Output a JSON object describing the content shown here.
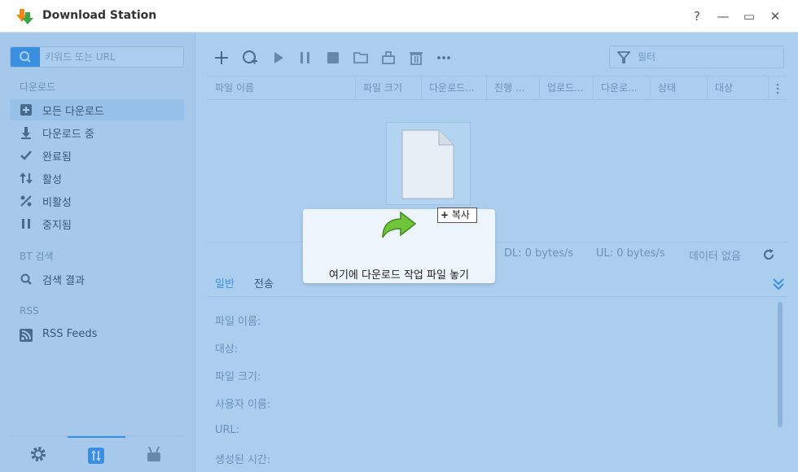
{
  "window": {
    "title": "Download Station"
  },
  "window_controls": {
    "help": "?",
    "minimize": "—",
    "maximize": "▭",
    "close": "✕"
  },
  "sidebar": {
    "search_placeholder": "키워드 또는 URL",
    "section_download": "다운로드",
    "items": [
      {
        "label": "모든 다운로드",
        "icon": "add-download-icon",
        "active": true
      },
      {
        "label": "다운로드 중",
        "icon": "download-arrow-icon"
      },
      {
        "label": "완료됨",
        "icon": "checkmark-icon"
      },
      {
        "label": "활성",
        "icon": "up-down-arrows-icon"
      },
      {
        "label": "비활성",
        "icon": "inactive-icon"
      },
      {
        "label": "중지됨",
        "icon": "pause-icon"
      }
    ],
    "section_bt": "BT 검색",
    "bt_items": [
      {
        "label": "검색 결과",
        "icon": "search-icon"
      }
    ],
    "section_rss": "RSS",
    "rss_items": [
      {
        "label": "RSS Feeds",
        "icon": "rss-icon"
      }
    ],
    "bottom_tabs": [
      "settings-icon",
      "transfer-icon",
      "robot-icon"
    ]
  },
  "toolbar": {
    "icons": [
      "add-icon",
      "add-url-icon",
      "play-icon",
      "pause-icon",
      "stop-icon",
      "folder-icon",
      "package-icon",
      "trash-icon",
      "more-icon"
    ],
    "filter_placeholder": "필터"
  },
  "table": {
    "columns": [
      "파일 이름",
      "파일 크기",
      "다운로드...",
      "진행 ...",
      "업로드...",
      "다운로...",
      "상태",
      "대상"
    ]
  },
  "status": {
    "dl": "DL: 0 bytes/s",
    "ul": "UL: 0 bytes/s",
    "no_data": "데이터 없음"
  },
  "detail_tabs": [
    "일반",
    "전송"
  ],
  "detail_labels": [
    "파일 이름:",
    "대상:",
    "파일 크기:",
    "사용자 이름:",
    "URL:",
    "생성된 시간:"
  ],
  "drop_zone": {
    "text": "여기에 다운로드 작업 파일 놓기",
    "copy_label": "복사"
  },
  "colors": {
    "accent": "#3d93e8",
    "overlay": "#3a8ad7"
  }
}
